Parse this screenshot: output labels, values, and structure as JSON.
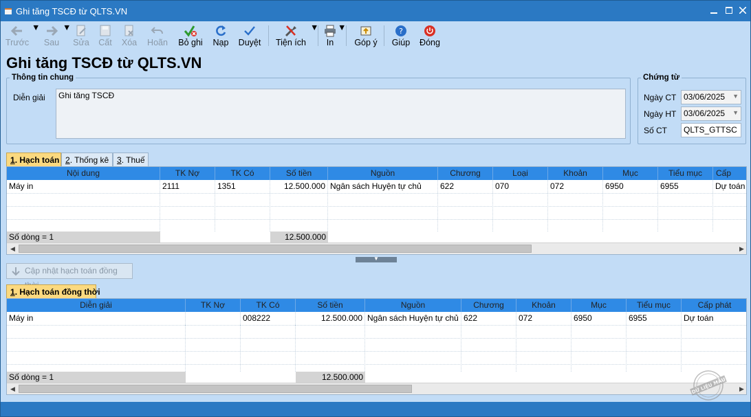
{
  "window": {
    "title": "Ghi tăng TSCĐ từ QLTS.VN"
  },
  "toolbar": {
    "prev": "Trước",
    "next": "Sau",
    "edit": "Sửa",
    "save": "Cất",
    "delete": "Xóa",
    "undo": "Hoãn",
    "unpost": "Bỏ ghi",
    "reload": "Nạp",
    "approve": "Duyệt",
    "utilities": "Tiện ích",
    "print": "In",
    "feedback": "Góp ý",
    "help": "Giúp",
    "close": "Đóng"
  },
  "page_title": "Ghi tăng TSCĐ từ QLTS.VN",
  "general": {
    "legend": "Thông tin chung",
    "desc_label": "Diễn giải",
    "desc_value": "Ghi tăng TSCĐ"
  },
  "voucher": {
    "legend": "Chứng từ",
    "date_ct_label": "Ngày CT",
    "date_ct_value": "03/06/2025",
    "date_ht_label": "Ngày HT",
    "date_ht_value": "03/06/2025",
    "no_label": "Số CT",
    "no_value": "QLTS_GTTSC"
  },
  "tabs1": [
    {
      "num": "1",
      "text": ". Hạch toán"
    },
    {
      "num": "2",
      "text": ". Thống kê"
    },
    {
      "num": "3",
      "text": ". Thuế"
    }
  ],
  "grid1": {
    "headers": [
      "Nội dung",
      "TK Nợ",
      "TK Có",
      "Số tiền",
      "Nguồn",
      "Chương",
      "Loại",
      "Khoản",
      "Mục",
      "Tiểu mục",
      "Cấp"
    ],
    "rows": [
      [
        "Máy in",
        "2111",
        "1351",
        "12.500.000",
        "Ngân sách Huyện tự chủ",
        "622",
        "070",
        "072",
        "6950",
        "6955",
        "Dự toán"
      ]
    ],
    "footer_count": "Số dòng = 1",
    "footer_total": "12.500.000"
  },
  "update_button": "Cập nhật hạch toán đồng thời",
  "tabs2": [
    {
      "num": "1",
      "text": ". Hạch toán đồng thời"
    }
  ],
  "grid2": {
    "headers": [
      "Diễn giải",
      "TK Nợ",
      "TK Có",
      "Số tiền",
      "Nguồn",
      "Chương",
      "Khoản",
      "Mục",
      "Tiểu mục",
      "Cấp phát"
    ],
    "rows": [
      [
        "Máy in",
        "",
        "008222",
        "12.500.000",
        "Ngân sách Huyện tự chủ",
        "622",
        "072",
        "6950",
        "6955",
        "Dự toán"
      ]
    ],
    "footer_count": "Số dòng = 1",
    "footer_total": "12.500.000"
  },
  "stamp_text": "DỮ LIỆU MẪU",
  "colors": {
    "titlebar": "#2b79c3",
    "background": "#c2dcf6",
    "grid_header": "#2f8ae5",
    "active_tab": "#fbd97f"
  }
}
